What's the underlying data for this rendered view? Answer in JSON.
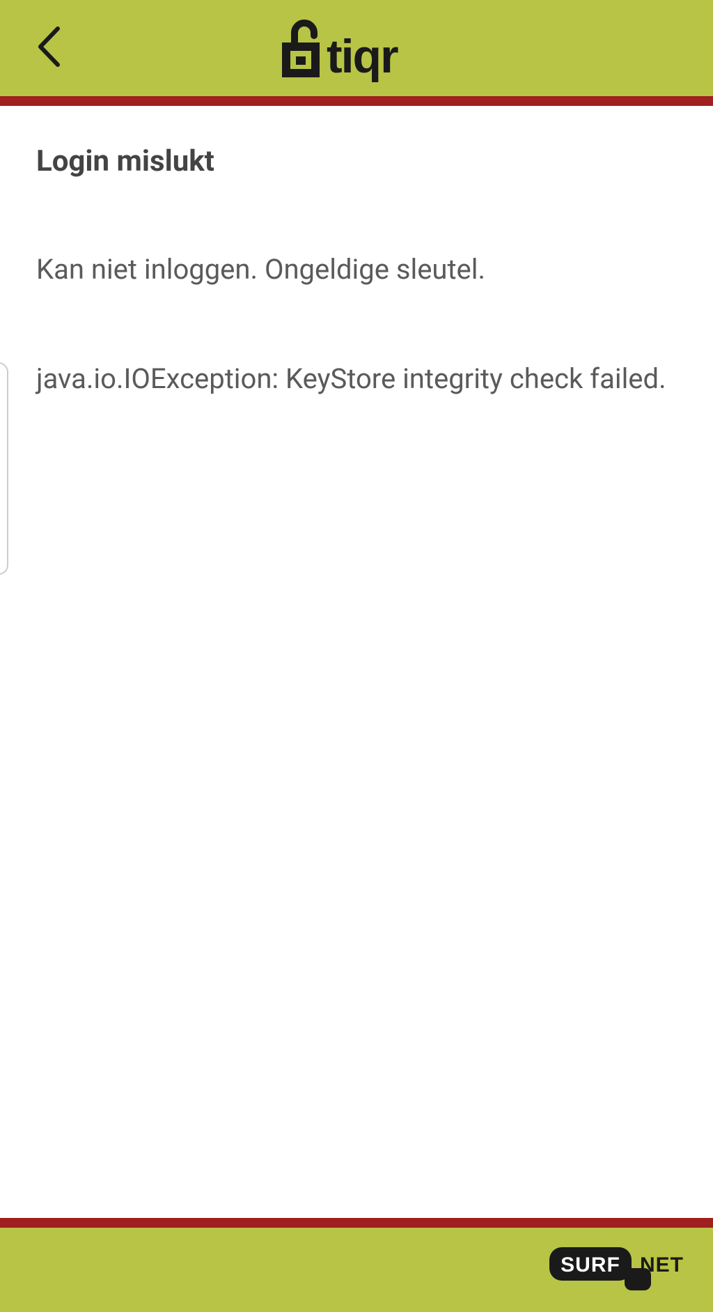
{
  "header": {
    "logo_text": "tiqr"
  },
  "content": {
    "title": "Login mislukt",
    "message": "Kan niet inloggen. Ongeldige sleutel.",
    "error_detail": "java.io.IOException: KeyStore integrity check failed."
  },
  "footer": {
    "logo_surf": "SURF",
    "logo_net": "NET"
  },
  "colors": {
    "header_bg": "#b8c445",
    "accent_bar": "#a01f1f",
    "text_primary": "#444",
    "text_secondary": "#5a5a5a"
  }
}
